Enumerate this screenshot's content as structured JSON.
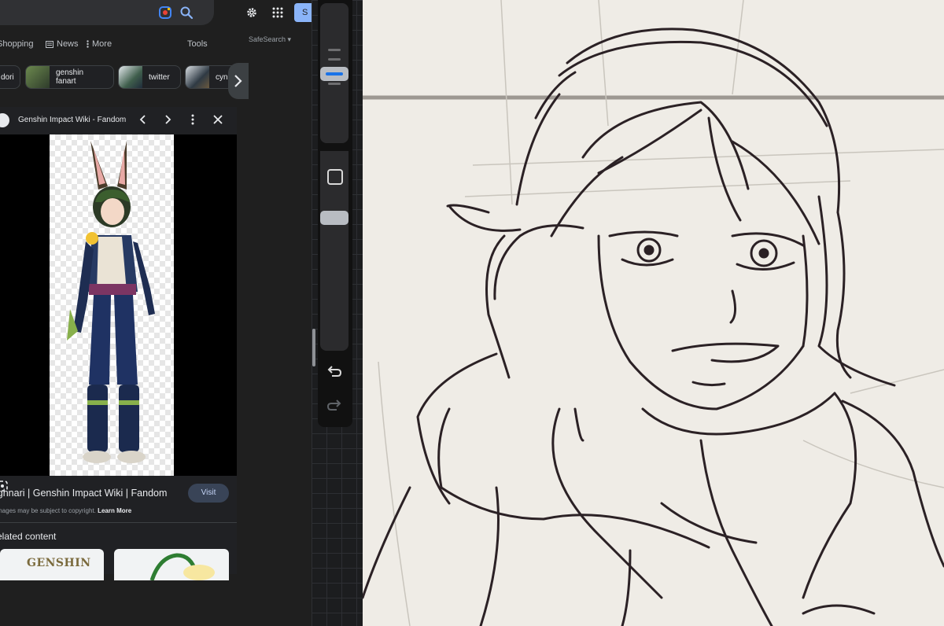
{
  "search": {
    "nav_tabs": [
      "Shopping",
      "News",
      "More"
    ],
    "tools_label": "Tools",
    "safesearch_label": "SafeSearch",
    "signin_partial": "S",
    "chips": [
      "dori",
      "genshin fanart",
      "twitter",
      "cyn"
    ]
  },
  "preview": {
    "source_name": "Genshin Impact Wiki - Fandom",
    "result_title": "ighnari | Genshin Impact Wiki | Fandom",
    "visit_label": "Visit",
    "copyright_text": "mages may be subject to copyright.",
    "learn_more_label": "Learn More",
    "related_heading": "elated content",
    "related_card_text": "GENSHIN"
  },
  "colors": {
    "accent_blue": "#1a73e8",
    "link_blue": "#8ab4f8",
    "canvas_paper": "#efece6",
    "sketch_ink": "#2b2125"
  },
  "icons": [
    "lens-icon",
    "search-icon",
    "gear-icon",
    "apps-grid-icon",
    "chevron-right-icon",
    "chevron-left-icon",
    "more-vert-icon",
    "close-icon",
    "undo-icon",
    "redo-icon"
  ]
}
